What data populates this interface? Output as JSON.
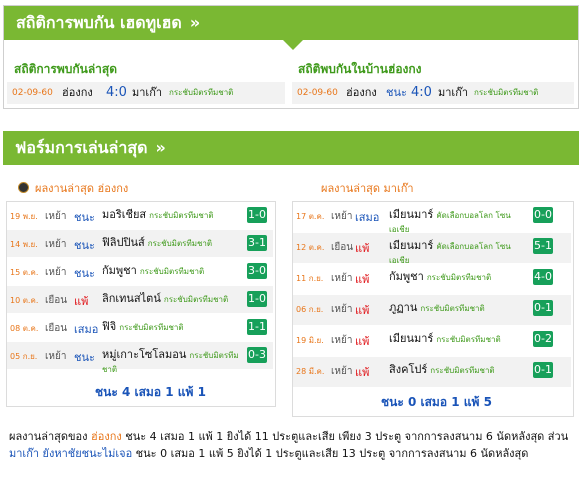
{
  "h2h": {
    "title": "สถิติการพบกัน เฮดทูเฮด",
    "left_title": "สถิติการพบกันล่าสุด",
    "right_title": "สถิติพบกันในบ้านฮ่องกง",
    "left_row": {
      "date": "02-09-60",
      "home": "ฮ่องกง",
      "score": "4:0",
      "away": "มาเก๊า",
      "comp": "กระชับมิตรทีมชาติ"
    },
    "right_row": {
      "date": "02-09-60",
      "home": "ฮ่องกง",
      "result": "ชนะ",
      "score": "4:0",
      "away": "มาเก๊า",
      "comp": "กระชับมิตรทีมชาติ"
    }
  },
  "form": {
    "title": "ฟอร์มการเล่นล่าสุด",
    "left": {
      "title": "ผลงานล่าสุด ฮ่องกง",
      "rows": [
        {
          "date": "19 พ.ย.",
          "ha": "เหย้า",
          "result": "ชนะ",
          "opp": "มอริเชียส",
          "comp": "กระชับมิตรทีมชาติ",
          "score": "1-0"
        },
        {
          "date": "14 พ.ย.",
          "ha": "เหย้า",
          "result": "ชนะ",
          "opp": "ฟิลิปปินส์",
          "comp": "กระชับมิตรทีมชาติ",
          "score": "3-1"
        },
        {
          "date": "15 ต.ค.",
          "ha": "เหย้า",
          "result": "ชนะ",
          "opp": "กัมพูชา",
          "comp": "กระชับมิตรทีมชาติ",
          "score": "3-0"
        },
        {
          "date": "10 ต.ค.",
          "ha": "เยือน",
          "result": "แพ้",
          "opp": "ลิกเทนสไตน์",
          "comp": "กระชับมิตรทีมชาติ",
          "score": "1-0"
        },
        {
          "date": "08 ต.ค.",
          "ha": "เยือน",
          "result": "เสมอ",
          "opp": "ฟิจิ",
          "comp": "กระชับมิตรทีมชาติ",
          "score": "1-1"
        },
        {
          "date": "05 ก.ย.",
          "ha": "เหย้า",
          "result": "ชนะ",
          "opp": "หมู่เกาะโซโลมอน",
          "comp": "กระชับมิตรทีมชาติ",
          "score": "0-3"
        }
      ],
      "summary": "ชนะ 4 เสมอ 1 แพ้ 1"
    },
    "right": {
      "title": "ผลงานล่าสุด มาเก๊า",
      "rows": [
        {
          "date": "17 ต.ค.",
          "ha": "เหย้า",
          "result": "เสมอ",
          "opp": "เมียนมาร์",
          "comp": "คัดเลือกบอลโลก โซนเอเชีย",
          "score": "0-0"
        },
        {
          "date": "12 ต.ค.",
          "ha": "เยือน",
          "result": "แพ้",
          "opp": "เมียนมาร์",
          "comp": "คัดเลือกบอลโลก โซนเอเชีย",
          "score": "5-1"
        },
        {
          "date": "11 ก.ย.",
          "ha": "เหย้า",
          "result": "แพ้",
          "opp": "กัมพูชา",
          "comp": "กระชับมิตรทีมชาติ",
          "score": "4-0"
        },
        {
          "date": "06 ก.ย.",
          "ha": "เหย้า",
          "result": "แพ้",
          "opp": "ภูฏาน",
          "comp": "กระชับมิตรทีมชาติ",
          "score": "0-1"
        },
        {
          "date": "19 มิ.ย.",
          "ha": "เหย้า",
          "result": "แพ้",
          "opp": "เมียนมาร์",
          "comp": "กระชับมิตรทีมชาติ",
          "score": "0-2"
        },
        {
          "date": "28 มี.ค.",
          "ha": "เหย้า",
          "result": "แพ้",
          "opp": "สิงคโปร์",
          "comp": "กระชับมิตรทีมชาติ",
          "score": "0-1"
        }
      ],
      "summary": "ชนะ 0 เสมอ 1 แพ้ 5"
    }
  },
  "paragraph": {
    "p1": "ผลงานล่าสุดของ",
    "team1": "ฮ่องกง",
    "p2": " ชนะ 4 เสมอ 1 แพ้ 1 ยิงได้ 11 ประตูและเสีย เพียง 3 ประตู จากการลงสนาม 6 นัดหลังสุด ส่วน ",
    "team2": "มาเก๊า",
    "p3": " ",
    "team2_status": "ยังหาชัยชนะไม่เจอ",
    "p4": " ชนะ 0 เสมอ 1 แพ้ 5 ยิงได้ 1 ประตูและเสีย 13 ประตู จากการลงสนาม 6 นัดหลังสุด"
  },
  "colors": {
    "header_green": "#7ab833",
    "subtitle_green": "#3f9a1b",
    "win_blue": "#1a54b8",
    "loss_red": "#e0161a",
    "score_badge": "#17a05a",
    "date_orange": "#e8761a"
  }
}
